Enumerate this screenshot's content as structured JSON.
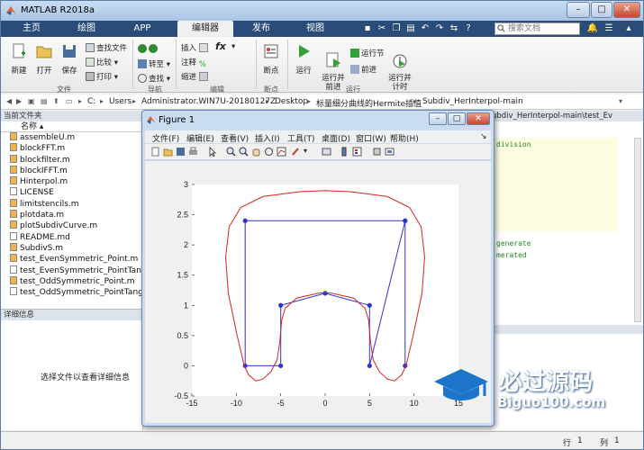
{
  "app": {
    "title": "MATLAB R2018a"
  },
  "window_buttons": [
    "–",
    "□",
    "✕"
  ],
  "tabs": [
    {
      "label": "主页"
    },
    {
      "label": "绘图"
    },
    {
      "label": "APP"
    },
    {
      "label": "编辑器"
    },
    {
      "label": "发布"
    },
    {
      "label": "视图"
    }
  ],
  "search": {
    "placeholder": "搜索文档"
  },
  "ribbon": {
    "file": {
      "new": "新建",
      "open": "打开",
      "save": "保存",
      "find_files": "查找文件",
      "compare": "比较",
      "print": "打印",
      "group": "文件"
    },
    "nav": {
      "goto": "转至",
      "find": "查找",
      "group": "导航"
    },
    "edit": {
      "insert": "插入",
      "comment": "注释",
      "indent": "缩进",
      "fx": "fx",
      "group": "编辑"
    },
    "breakpoints": {
      "label": "断点",
      "group": "断点"
    },
    "run": {
      "run": "运行",
      "run_advance": "运行并\n前进",
      "run_section": "运行节",
      "advance": "前进",
      "run_time": "运行并\n计时",
      "group": "运行"
    }
  },
  "address": {
    "parts": [
      "C:",
      "Users",
      "Administrator.WIN7U-20180127Z",
      "Desktop",
      "标量细分曲线的Hermite插值",
      "Subdiv_HerInterpol-main"
    ]
  },
  "current_folder": {
    "title": "当前文件夹",
    "col_header": "名称",
    "files": [
      "assembleU.m",
      "blockFFT.m",
      "blockfilter.m",
      "blockIFFT.m",
      "Hinterpol.m",
      "LICENSE",
      "limitstencils.m",
      "plotdata.m",
      "plotSubdivCurve.m",
      "README.md",
      "SubdivS.m",
      "test_EvenSymmetric_Point.m",
      "test_EvenSymmetric_PointTange",
      "test_OddSymmetric_Point.m",
      "test_OddSymmetric_PointTange"
    ]
  },
  "details": {
    "title": "详细信息",
    "message": "选择文件以查看详细信息"
  },
  "editor": {
    "tab": "ubdiv_HerInterpol-main\\test_Ev",
    "lines": [
      "division",
      "generate",
      "merated"
    ]
  },
  "status": {
    "row_label": "行",
    "row": "1",
    "col_label": "列",
    "col": "1"
  },
  "figure": {
    "title": "Figure 1",
    "menu": [
      "文件(F)",
      "编辑(E)",
      "查看(V)",
      "插入(I)",
      "工具(T)",
      "桌面(D)",
      "窗口(W)",
      "帮助(H)"
    ]
  },
  "watermark": {
    "cn": "必过源码",
    "en": "Biguo100.com"
  },
  "chart_data": {
    "type": "line",
    "xlim": [
      -15,
      15
    ],
    "ylim": [
      -0.5,
      3
    ],
    "xticks": [
      -15,
      -10,
      -5,
      0,
      5,
      10,
      15
    ],
    "yticks": [
      -0.5,
      0,
      0.5,
      1,
      1.5,
      2,
      2.5,
      3
    ],
    "grid": false,
    "series": [
      {
        "style": "control-polygon",
        "color": "#3333cc",
        "x": [
          9,
          9,
          5,
          5,
          0,
          -5,
          -5,
          -9,
          -9,
          9
        ],
        "y": [
          0,
          2.4,
          0,
          1,
          1.2,
          1,
          0,
          0,
          2.4,
          2.4
        ],
        "markers": true
      },
      {
        "style": "subdivision-curve",
        "color": "#dd2222",
        "x": [
          9.1,
          9.9,
          10.9,
          11.2,
          10.8,
          9.5,
          7.0,
          3.0,
          0.0,
          -3.0,
          -7.0,
          -9.5,
          -10.8,
          -11.2,
          -10.9,
          -9.9,
          -9.1,
          -8.6,
          -7.8,
          -7.0,
          -6.1,
          -5.4,
          -5.1,
          -4.9,
          -4.5,
          -3.2,
          -0.8,
          0.0,
          0.8,
          3.2,
          4.5,
          4.9,
          5.1,
          5.4,
          6.1,
          7.0,
          7.8,
          8.6,
          9.1
        ],
        "y": [
          0.0,
          0.5,
          1.2,
          1.8,
          2.3,
          2.62,
          2.8,
          2.88,
          2.9,
          2.88,
          2.8,
          2.62,
          2.3,
          1.8,
          1.2,
          0.5,
          0.0,
          -0.15,
          -0.25,
          -0.22,
          -0.1,
          0.1,
          0.4,
          0.75,
          0.95,
          1.12,
          1.2,
          1.21,
          1.2,
          1.12,
          0.95,
          0.75,
          0.4,
          0.1,
          -0.1,
          -0.22,
          -0.25,
          -0.15,
          0.0
        ],
        "markers": false
      }
    ]
  }
}
